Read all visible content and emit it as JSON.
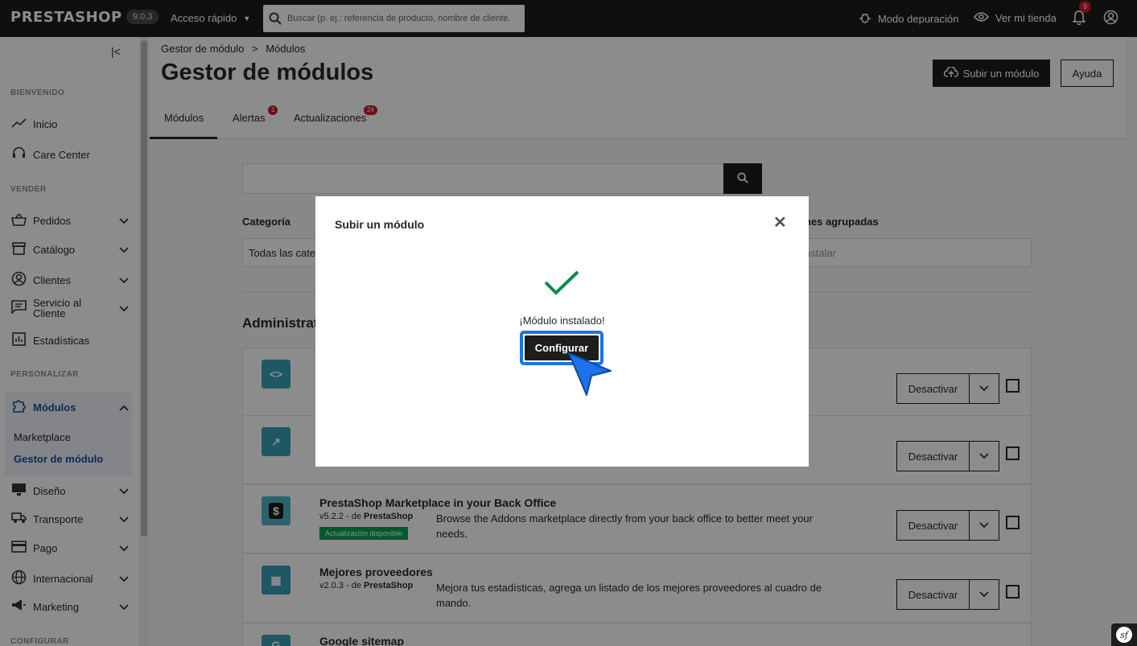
{
  "topbar": {
    "logo": "PRESTASHOP",
    "version": "9.0.3",
    "quick_access": "Acceso rápido",
    "search_placeholder": "Buscar (p. ej.: referencia de producto, nombre de cliente.",
    "debug_mode": "Modo depuración",
    "view_store": "Ver mi tienda",
    "notifications_count": "9"
  },
  "sidebar": {
    "sections": {
      "welcome": "BIENVENIDO",
      "sell": "VENDER",
      "customize": "PERSONALIZAR",
      "configure": "CONFIGURAR"
    },
    "items": {
      "inicio": "Inicio",
      "care_center": "Care Center",
      "pedidos": "Pedidos",
      "catalogo": "Catálogo",
      "clientes": "Clientes",
      "servicio_1": "Servicio al",
      "servicio_2": "Cliente",
      "estadisticas": "Estadísticas",
      "modulos": "Módulos",
      "marketplace": "Marketplace",
      "gestor": "Gestor de módulo",
      "diseno": "Diseño",
      "transporte": "Transporte",
      "pago": "Pago",
      "internacional": "Internacional",
      "marketing": "Marketing"
    }
  },
  "header": {
    "breadcrumb_parent": "Gestor de módulo",
    "breadcrumb_sep": ">",
    "breadcrumb_current": "Módulos",
    "title": "Gestor de módulos",
    "upload_button": "Subir un módulo",
    "help_button": "Ayuda",
    "tabs": [
      {
        "label": "Módulos"
      },
      {
        "label": "Alertas",
        "badge": "1"
      },
      {
        "label": "Actualizaciones",
        "badge": "24"
      }
    ]
  },
  "filters": {
    "category_label": "Categoría",
    "category_value": "Todas las categ",
    "grouped_label": "nes agrupadas",
    "grouped_value": "nstalar"
  },
  "section_title": "Administrat",
  "modules": [
    {
      "name": "",
      "version": "",
      "author": "",
      "desc": "",
      "badge": "",
      "action": "Desactivar"
    },
    {
      "name": "",
      "version": "",
      "author": "",
      "desc": "",
      "badge": "",
      "action": "Desactivar"
    },
    {
      "name": "PrestaShop Marketplace in your Back Office",
      "version": "v5.2.2 - de ",
      "author": "PrestaShop",
      "desc": "Browse the Addons marketplace directly from your back office to better meet your needs.",
      "badge": "Actualización disponible",
      "action": "Desactivar"
    },
    {
      "name": "Mejores proveedores",
      "version": "v2.0.3 - de ",
      "author": "PrestaShop",
      "desc": "Mejora tus estadísticas, agrega un listado de los mejores proveedores al cuadro de mando.",
      "badge": "",
      "action": "Desactivar"
    },
    {
      "name": "Google sitemap",
      "version": "",
      "author": "",
      "desc": "",
      "badge": "",
      "action": ""
    }
  ],
  "modal": {
    "title": "Subir un módulo",
    "message": "¡Módulo instalado!",
    "configure_button": "Configurar"
  },
  "colors": {
    "brand_dark": "#1d1d1b",
    "accent_blue": "#1a73e8",
    "success_green": "#0b8a4a",
    "badge_red": "#c71c2c"
  }
}
